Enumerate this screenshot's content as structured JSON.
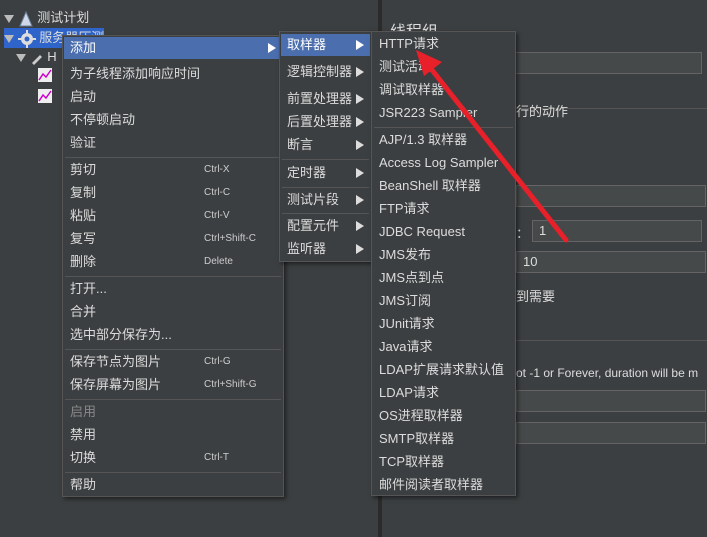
{
  "tree": {
    "test_plan": "测试计划",
    "thread_group": "服务器压测",
    "child_prefix": "H"
  },
  "right_panel": {
    "title": "线程组",
    "action_label": "行的动作",
    "loop_label": "：",
    "loop_value": "1",
    "value_10": "10",
    "delay_text": "到需要",
    "duration_text": "ot -1 or Forever, duration will be m"
  },
  "context_menu": {
    "items": [
      {
        "label": "添加",
        "submenu": true,
        "highlight": true
      },
      {
        "label": "为子线程添加响应时间"
      },
      {
        "label": "启动"
      },
      {
        "label": "不停顿启动"
      },
      {
        "label": "验证"
      },
      {
        "label": "剪切",
        "shortcut": "Ctrl-X"
      },
      {
        "label": "复制",
        "shortcut": "Ctrl-C"
      },
      {
        "label": "粘贴",
        "shortcut": "Ctrl-V"
      },
      {
        "label": "复写",
        "shortcut": "Ctrl+Shift-C"
      },
      {
        "label": "删除",
        "shortcut": "Delete"
      },
      {
        "label": "打开..."
      },
      {
        "label": "合并"
      },
      {
        "label": "选中部分保存为..."
      },
      {
        "label": "保存节点为图片",
        "shortcut": "Ctrl-G"
      },
      {
        "label": "保存屏幕为图片",
        "shortcut": "Ctrl+Shift-G"
      },
      {
        "label": "启用",
        "disabled": true
      },
      {
        "label": "禁用"
      },
      {
        "label": "切换",
        "shortcut": "Ctrl-T"
      },
      {
        "label": "帮助"
      }
    ]
  },
  "add_submenu": {
    "items": [
      {
        "label": "取样器",
        "highlight": true
      },
      {
        "label": "逻辑控制器"
      },
      {
        "label": "前置处理器"
      },
      {
        "label": "后置处理器"
      },
      {
        "label": "断言"
      },
      {
        "label": "定时器"
      },
      {
        "label": "测试片段"
      },
      {
        "label": "配置元件"
      },
      {
        "label": "监听器"
      }
    ]
  },
  "sampler_submenu": {
    "items": [
      "HTTP请求",
      "测试活动",
      "调试取样器",
      "JSR223 Sampler",
      "AJP/1.3 取样器",
      "Access Log Sampler",
      "BeanShell 取样器",
      "FTP请求",
      "JDBC Request",
      "JMS发布",
      "JMS点到点",
      "JMS订阅",
      "JUnit请求",
      "Java请求",
      "LDAP扩展请求默认值",
      "LDAP请求",
      "OS进程取样器",
      "SMTP取样器",
      "TCP取样器",
      "邮件阅读者取样器"
    ]
  },
  "colors": {
    "background": "#3c3f41",
    "highlight": "#4b6eaf",
    "annotation_arrow": "#e8202a"
  }
}
